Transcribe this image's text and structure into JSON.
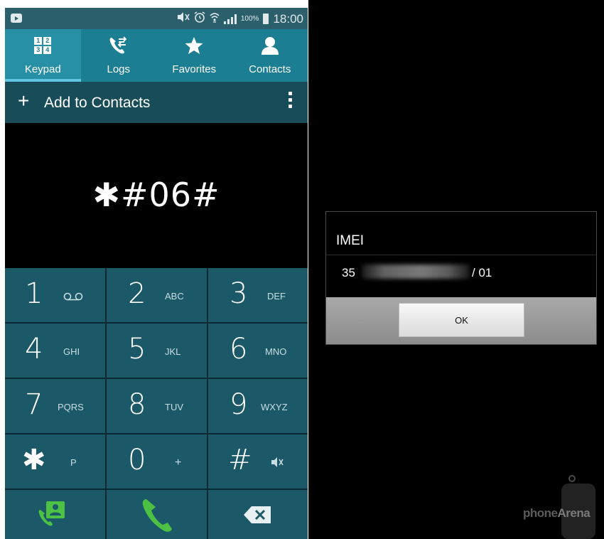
{
  "status_bar": {
    "battery_percent": "100%",
    "time": "18:00",
    "icons": [
      "media-playing-icon",
      "mute-icon",
      "alarm-icon",
      "wifi-icon",
      "signal-icon",
      "battery-icon"
    ]
  },
  "tabs": [
    {
      "label": "Keypad",
      "icon": "keypad-icon",
      "active": true
    },
    {
      "label": "Logs",
      "icon": "logs-icon",
      "active": false
    },
    {
      "label": "Favorites",
      "icon": "star-icon",
      "active": false
    },
    {
      "label": "Contacts",
      "icon": "contact-icon",
      "active": false
    }
  ],
  "keypad_icon_digits": [
    "1",
    "2",
    "3",
    "4"
  ],
  "action_bar": {
    "add_label": "Add to Contacts",
    "plus": "+"
  },
  "dialed_number": "✱#06#",
  "keys": [
    {
      "digit": "1",
      "letters": "",
      "icon": "voicemail-icon"
    },
    {
      "digit": "2",
      "letters": "ABC"
    },
    {
      "digit": "3",
      "letters": "DEF"
    },
    {
      "digit": "4",
      "letters": "GHI"
    },
    {
      "digit": "5",
      "letters": "JKL"
    },
    {
      "digit": "6",
      "letters": "MNO"
    },
    {
      "digit": "7",
      "letters": "PQRS"
    },
    {
      "digit": "8",
      "letters": "TUV"
    },
    {
      "digit": "9",
      "letters": "WXYZ"
    },
    {
      "digit": "✱",
      "letters": "P"
    },
    {
      "digit": "0",
      "letters": "+"
    },
    {
      "digit": "#",
      "letters": "",
      "icon": "mute-icon"
    }
  ],
  "bottom_row": [
    "add-contact-icon",
    "call-icon",
    "backspace-icon"
  ],
  "dialog": {
    "title": "IMEI",
    "imei_prefix": "35",
    "imei_suffix": "/ 01",
    "ok_label": "OK"
  },
  "watermark": {
    "brand_a": "phone",
    "brand_b": "Arena"
  },
  "colors": {
    "tab_bar": "#1c7e93",
    "action_bar": "#174c58",
    "key": "#1b5868",
    "call_green": "#4cc144"
  }
}
